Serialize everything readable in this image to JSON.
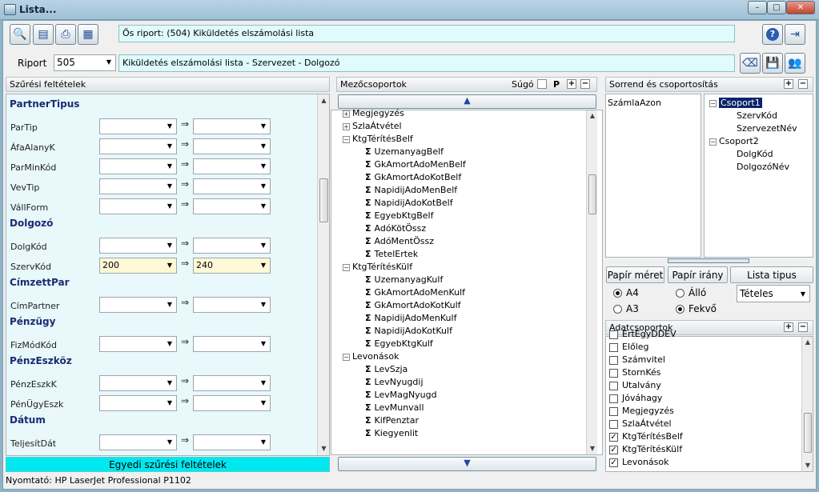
{
  "window": {
    "title": "Lista...",
    "minimize": "–",
    "maximize": "□",
    "close": "✕"
  },
  "header": {
    "orig_report": "Ős riport: (504)  Kiküldetés elszámolási lista",
    "riport_label": "Riport",
    "riport_value": "505",
    "riport_desc": "Kiküldetés elszámolási lista - Szervezet - Dolgozó"
  },
  "filters": {
    "title": "Szűrési feltételek",
    "groups": [
      {
        "name": "PartnerTipus",
        "fields": [
          {
            "label": "ParTip",
            "from": "",
            "to": ""
          },
          {
            "label": "ÁfaAlanyK",
            "from": "",
            "to": ""
          },
          {
            "label": "ParMinKód",
            "from": "",
            "to": ""
          },
          {
            "label": "VevTip",
            "from": "",
            "to": ""
          },
          {
            "label": "VállForm",
            "from": "",
            "to": ""
          }
        ]
      },
      {
        "name": "Dolgozó",
        "fields": [
          {
            "label": "DolgKód",
            "from": "",
            "to": ""
          },
          {
            "label": "SzervKód",
            "from": "200",
            "to": "240"
          }
        ]
      },
      {
        "name": "CímzettPar",
        "fields": [
          {
            "label": "CímPartner",
            "from": "",
            "to": ""
          }
        ]
      },
      {
        "name": "Pénzügy",
        "fields": [
          {
            "label": "FizMódKód",
            "from": "",
            "to": ""
          }
        ]
      },
      {
        "name": "PénzEszköz",
        "fields": [
          {
            "label": "PénzEszkK",
            "from": "",
            "to": ""
          },
          {
            "label": "PénÜgyEszk",
            "from": "",
            "to": ""
          }
        ]
      },
      {
        "name": "Dátum",
        "fields": [
          {
            "label": "TeljesítDát",
            "from": "",
            "to": ""
          }
        ]
      }
    ],
    "arrow": "⇒",
    "footer_button": "Egyedi szűrési feltételek"
  },
  "fields": {
    "title": "Mezőcsoportok",
    "help_label": "Súgó",
    "p_label": "P",
    "tree": [
      {
        "type": "group",
        "label": "Megjegyzés",
        "expanded": false
      },
      {
        "type": "group",
        "label": "SzlaÁtvétel",
        "expanded": false
      },
      {
        "type": "group",
        "label": "KtgTérítésBelf",
        "expanded": true,
        "children": [
          "UzemanyagBelf",
          "GkAmortAdoMenBelf",
          "GkAmortAdoKotBelf",
          "NapidijAdoMenBelf",
          "NapidijAdoKotBelf",
          "EgyebKtgBelf",
          "AdóKötÖssz",
          "AdóMentÖssz",
          "TetelErtek"
        ]
      },
      {
        "type": "group",
        "label": "KtgTérítésKülf",
        "expanded": true,
        "children": [
          "UzemanyagKulf",
          "GkAmortAdoMenKulf",
          "GkAmortAdoKotKulf",
          "NapidijAdoMenKulf",
          "NapidijAdoKotKulf",
          "EgyebKtgKulf"
        ]
      },
      {
        "type": "group",
        "label": "Levonások",
        "expanded": true,
        "children": [
          "LevSzja",
          "LevNyugdij",
          "LevMagNyugd",
          "LevMunvall",
          "KifPenztar",
          "Kiegyenlit"
        ]
      }
    ]
  },
  "sort": {
    "title": "Sorrend és csoportosítás",
    "order_items": [
      "SzámlaAzon"
    ],
    "groups": [
      {
        "label": "Csoport1",
        "children": [
          "SzervKód",
          "SzervezetNév"
        ]
      },
      {
        "label": "Csoport2",
        "children": [
          "DolgKód",
          "DolgozóNév"
        ]
      }
    ]
  },
  "paper": {
    "size_label": "Papír méret",
    "orient_label": "Papír irány",
    "list_type_label": "Lista tipus",
    "a4": "A4",
    "a3": "A3",
    "allo": "Álló",
    "fekvo": "Fekvő",
    "list_type_value": "Tételes"
  },
  "datagroups": {
    "title": "Adatcsoportok",
    "items": [
      {
        "label": "ErtEgyDDEV",
        "checked": false
      },
      {
        "label": "Előleg",
        "checked": false
      },
      {
        "label": "Számvitel",
        "checked": false
      },
      {
        "label": "StornKés",
        "checked": false
      },
      {
        "label": "Utalvány",
        "checked": false
      },
      {
        "label": "Jóváhagy",
        "checked": false
      },
      {
        "label": "Megjegyzés",
        "checked": false
      },
      {
        "label": "SzlaÁtvétel",
        "checked": false
      },
      {
        "label": "KtgTérítésBelf",
        "checked": true
      },
      {
        "label": "KtgTérítésKülf",
        "checked": true
      },
      {
        "label": "Levonások",
        "checked": true
      }
    ]
  },
  "status": {
    "printer": "Nyomtató: HP LaserJet Professional P1102"
  }
}
